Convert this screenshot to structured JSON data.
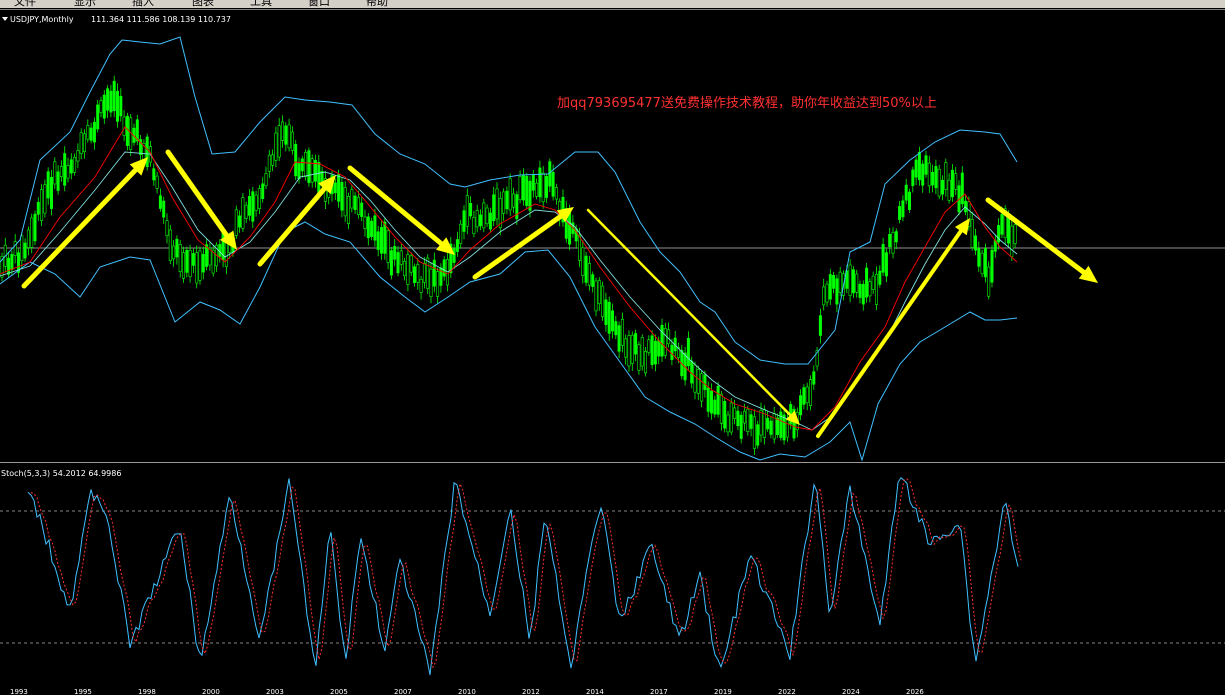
{
  "menubar": {
    "items": [
      "文件",
      "显示",
      "插入",
      "图表",
      "工具",
      "窗口",
      "帮助"
    ]
  },
  "main_chart": {
    "symbol_label": "USDJPY,Monthly",
    "ohlc_label": "111.364 111.586 108.139 110.737",
    "watermark": "加qq793695477送免费操作技术教程，助你年收益达到50%以上"
  },
  "indicator": {
    "label": "Stoch(5,3,3) 54.2012 64.9986"
  },
  "colors": {
    "candle": "#00ff00",
    "bands": "#40c0ff",
    "ma_red": "#ff0000",
    "ma_cyan": "#7fe0e0",
    "arrow": "#ffff00",
    "stoch_main": "#40c0ff",
    "stoch_signal": "#ff3030",
    "watermark": "#ff3030"
  },
  "xaxis": {
    "labels": [
      "1993",
      "1995",
      "1998",
      "2000",
      "2003",
      "2005",
      "2007",
      "2010",
      "2012",
      "2014",
      "2017",
      "2019",
      "2022",
      "2024",
      "2026"
    ]
  }
}
